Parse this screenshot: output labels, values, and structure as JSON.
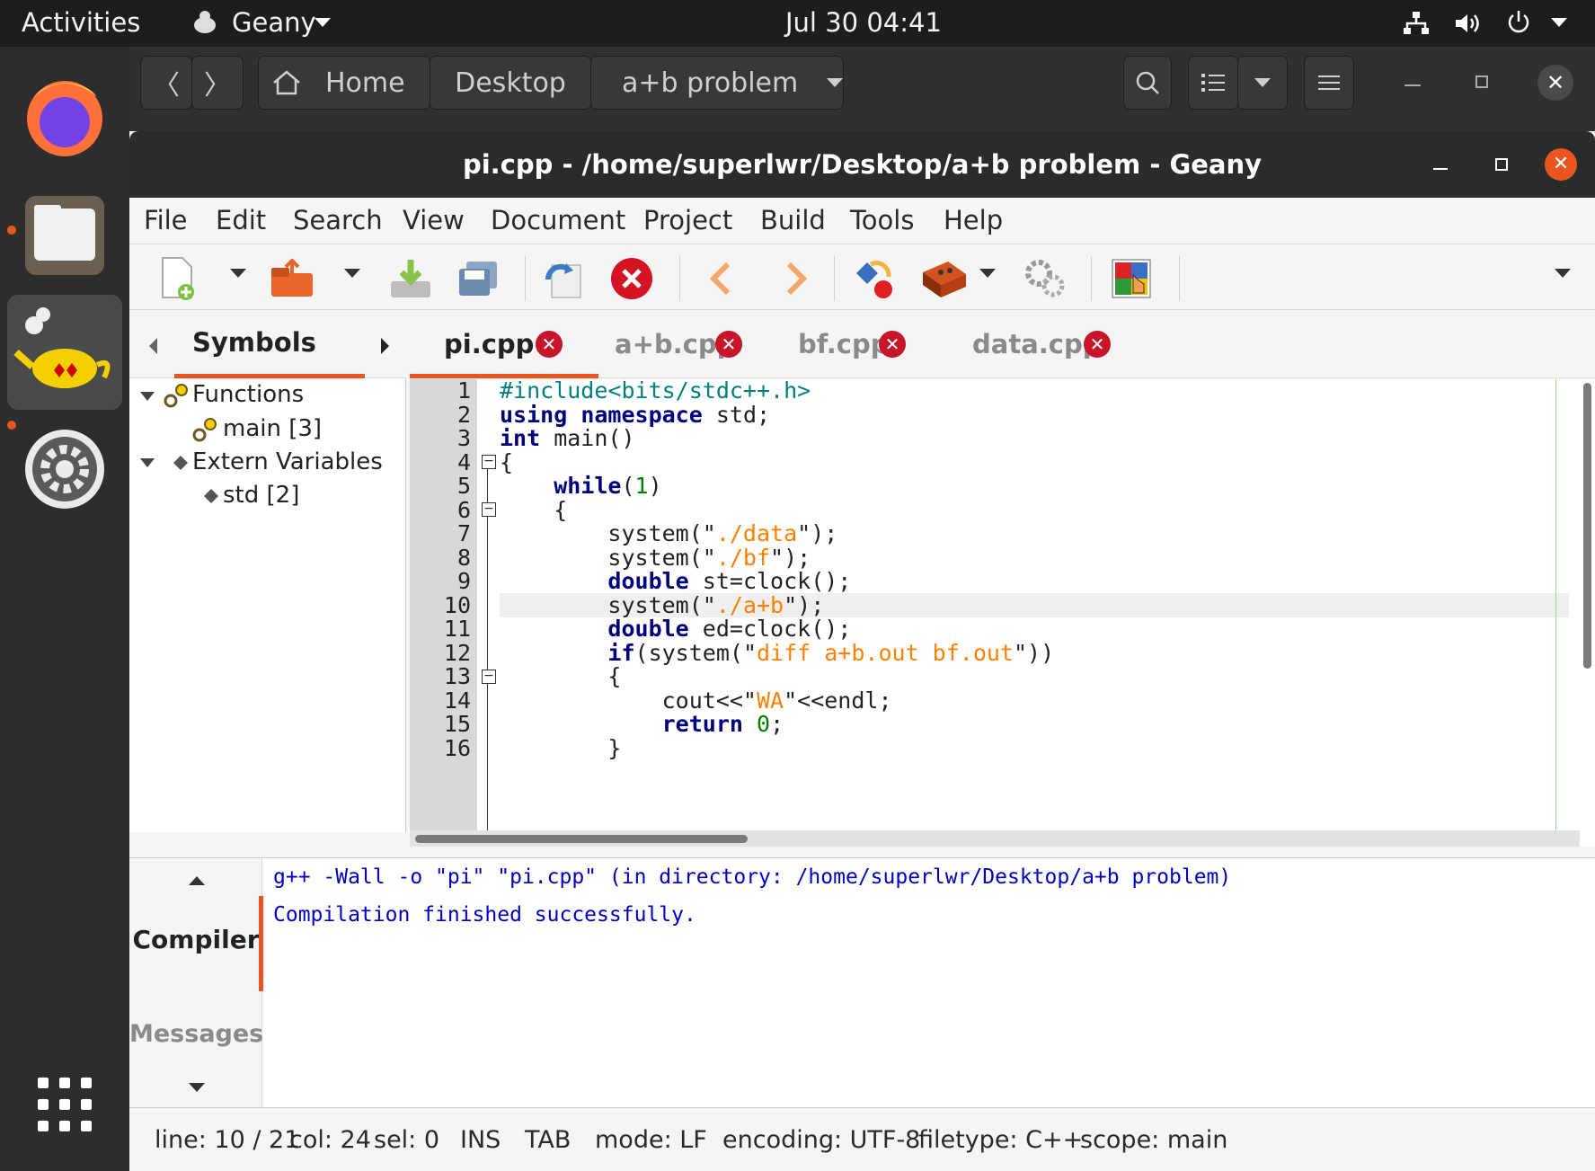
{
  "topbar": {
    "activities": "Activities",
    "app_name": "Geany",
    "clock": "Jul 30  04:41"
  },
  "files_window": {
    "breadcrumbs": [
      "Home",
      "Desktop",
      "a+b problem"
    ]
  },
  "window": {
    "title": "pi.cpp - /home/superlwr/Desktop/a+b problem - Geany"
  },
  "menu": [
    "File",
    "Edit",
    "Search",
    "View",
    "Document",
    "Project",
    "Build",
    "Tools",
    "Help"
  ],
  "sidebar": {
    "tab": "Symbols",
    "tree": [
      {
        "label": "Functions"
      },
      {
        "label": "main [3]"
      },
      {
        "label": "Extern Variables"
      },
      {
        "label": "std [2]"
      }
    ]
  },
  "editor_tabs": [
    {
      "label": "pi.cpp",
      "active": true
    },
    {
      "label": "a+b.cpp",
      "active": false
    },
    {
      "label": "bf.cpp",
      "active": false
    },
    {
      "label": "data.cpp",
      "active": false
    }
  ],
  "code_lines": [
    "#include<bits/stdc++.h>",
    "using namespace std;",
    "int main()",
    "{",
    "    while(1)",
    "    {",
    "        system(\"./data\");",
    "        system(\"./bf\");",
    "        double st=clock();",
    "        system(\"./a+b\");",
    "        double ed=clock();",
    "        if(system(\"diff a+b.out bf.out\"))",
    "        {",
    "            cout<<\"WA\"<<endl;",
    "            return 0;",
    "        }"
  ],
  "line_numbers": [
    "1",
    "2",
    "3",
    "4",
    "5",
    "6",
    "7",
    "8",
    "9",
    "10",
    "11",
    "12",
    "13",
    "14",
    "15",
    "16"
  ],
  "message_panel": {
    "tabs": [
      "Compiler",
      "Messages"
    ],
    "active_tab": "Compiler",
    "lines": [
      "g++ -Wall -o \"pi\" \"pi.cpp\" (in directory: /home/superlwr/Desktop/a+b problem)",
      "Compilation finished successfully."
    ]
  },
  "status_bar": {
    "line": "line: 10 / 21",
    "col": "col: 24",
    "sel": "sel: 0",
    "ins": "INS",
    "tab": "TAB",
    "mode": "mode: LF",
    "encoding": "encoding: UTF-8",
    "filetype": "filetype: C++",
    "scope": "scope: main"
  },
  "colors": {
    "accent": "#e95420",
    "close_red": "#c7162b",
    "keyword": "#00007f",
    "string": "#ff8000",
    "preprocessor": "#007f7f",
    "number": "#007f00",
    "compiler_text": "#0000c0"
  }
}
